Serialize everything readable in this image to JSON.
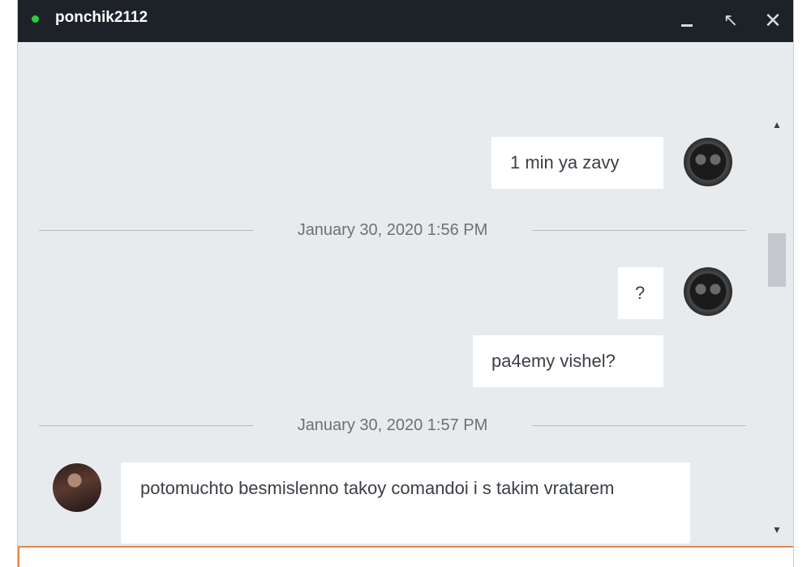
{
  "window": {
    "title": "ponchik2112",
    "status_color": "#2ecc40",
    "controls": {
      "minimize": "_",
      "expand": "↖",
      "close": "✕"
    }
  },
  "messages": [
    {
      "type": "message",
      "side": "right",
      "text": "1 min ya zavy",
      "avatar": "sunglasses-avatar"
    },
    {
      "type": "divider",
      "text": "January 30, 2020 1:56 PM"
    },
    {
      "type": "message",
      "side": "right",
      "text": "?",
      "avatar": "sunglasses-avatar"
    },
    {
      "type": "message",
      "side": "right",
      "text": "pa4emy vishel?"
    },
    {
      "type": "divider",
      "text": "January 30, 2020 1:57 PM"
    },
    {
      "type": "message",
      "side": "left",
      "text": "potomuchto besmislenno takoy comandoi i s takim vratarem",
      "avatar": "user-avatar"
    }
  ],
  "scrollbar": {
    "up_arrow": "▲",
    "down_arrow": "▼"
  },
  "composer": {
    "value": "",
    "placeholder": "",
    "accent_color": "#e0894f"
  }
}
